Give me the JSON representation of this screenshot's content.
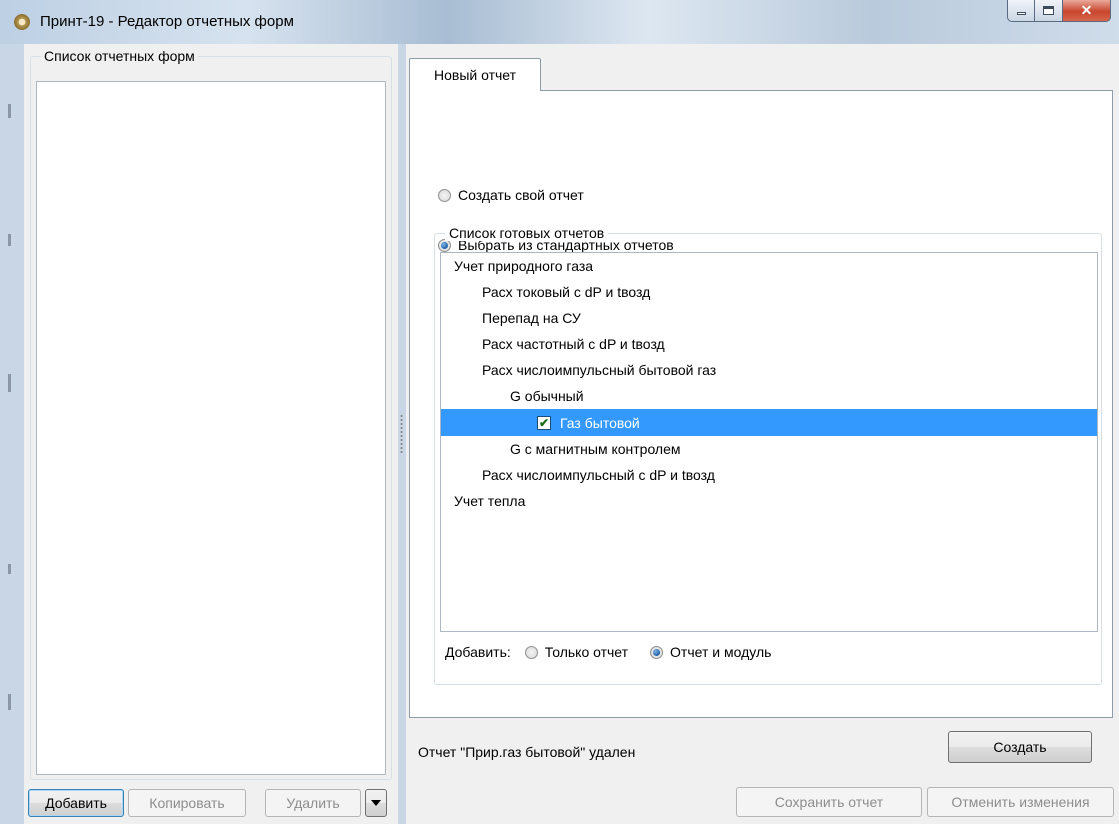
{
  "window": {
    "title": "Принт-19 - Редактор отчетных форм"
  },
  "left": {
    "group_title": "Список отчетных форм",
    "buttons": {
      "add": "Добавить",
      "copy": "Копировать",
      "delete": "Удалить"
    }
  },
  "tab": {
    "label": "Новый отчет"
  },
  "options": {
    "create_own": "Создать свой отчет",
    "choose_standard": "Выбрать из стандартных отчетов",
    "selected": "choose_standard"
  },
  "reports": {
    "group_title": "Список готовых отчетов",
    "tree": [
      {
        "label": "Учет природного газа",
        "level": 0
      },
      {
        "label": "Расх токовый с dP и tвозд",
        "level": 1
      },
      {
        "label": "Перепад на СУ",
        "level": 1
      },
      {
        "label": "Расх частотный с dP и tвозд",
        "level": 1
      },
      {
        "label": "Расх числоимпульсный бытовой газ",
        "level": 1
      },
      {
        "label": "G обычный",
        "level": 2
      },
      {
        "label": "Газ бытовой",
        "level": 3,
        "checked": true,
        "selected": true
      },
      {
        "label": "G с магнитным контролем",
        "level": 2
      },
      {
        "label": "Расх числоимпульсный с dP и tвозд",
        "level": 1
      },
      {
        "label": "Учет тепла",
        "level": 0
      }
    ],
    "add_label": "Добавить:",
    "add_only_report": "Только отчет",
    "add_report_and_module": "Отчет и модуль",
    "add_selected": "report_and_module"
  },
  "buttons": {
    "create": "Создать",
    "save": "Сохранить отчет",
    "cancel": "Отменить изменения"
  },
  "status": {
    "message": "Отчет \"Прир.газ бытовой\" удален"
  },
  "colors": {
    "selection": "#3399ff",
    "frame": "#c9d6e6",
    "close_button": "#c8462d"
  }
}
